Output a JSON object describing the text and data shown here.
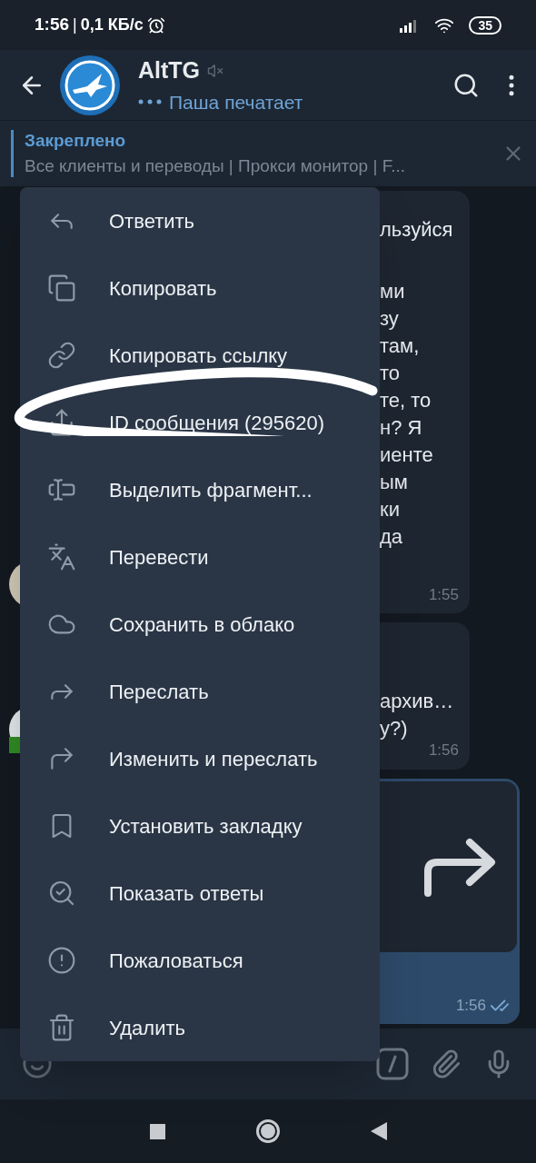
{
  "status_bar": {
    "time": "1:56",
    "separator": "|",
    "speed": "0,1 КБ/с",
    "battery": "35"
  },
  "header": {
    "title": "AltTG",
    "muted": true,
    "subtitle": "Паша печатает"
  },
  "pinned": {
    "title": "Закреплено",
    "text": "Все клиенты и переводы | Прокси монитор | F..."
  },
  "messages": [
    {
      "kind": "incoming",
      "groups": [
        [
          "льзуйся"
        ],
        [
          "ми",
          "зу",
          "там,",
          "то",
          "те, то",
          "н? Я",
          "иенте",
          "ым",
          "ки",
          "да"
        ]
      ],
      "time": "1:55"
    },
    {
      "kind": "incoming",
      "groups": [
        [
          "архив…",
          "у?)"
        ]
      ],
      "time": "1:56"
    },
    {
      "kind": "forwarded",
      "time": "1:56",
      "read": true
    }
  ],
  "menu": [
    {
      "label": "Ответить"
    },
    {
      "label": "Копировать"
    },
    {
      "label": "Копировать ссылку"
    },
    {
      "label": "ID сообщения (295620)"
    },
    {
      "label": "Выделить фрагмент..."
    },
    {
      "label": "Перевести"
    },
    {
      "label": "Сохранить в облако"
    },
    {
      "label": "Переслать"
    },
    {
      "label": "Изменить и переслать"
    },
    {
      "label": "Установить закладку"
    },
    {
      "label": "Показать ответы"
    },
    {
      "label": "Пожаловаться"
    },
    {
      "label": "Удалить"
    }
  ]
}
